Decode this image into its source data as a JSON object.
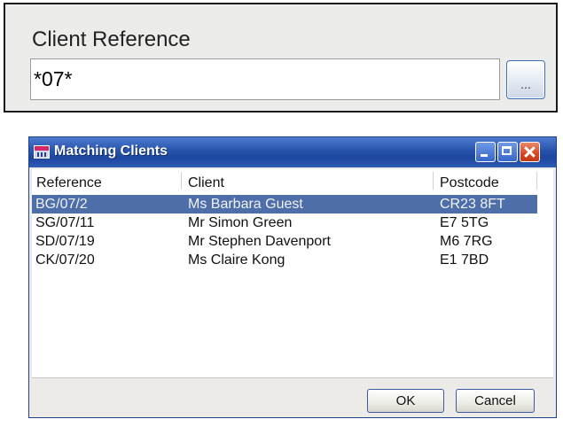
{
  "reference_panel": {
    "label": "Client Reference",
    "input_value": "*07*",
    "browse_label": "..."
  },
  "dialog": {
    "title": "Matching Clients",
    "columns": [
      "Reference",
      "Client",
      "Postcode"
    ],
    "rows": [
      {
        "reference": "BG/07/2",
        "client": "Ms Barbara Guest",
        "postcode": "CR23 8FT",
        "selected": true
      },
      {
        "reference": "SG/07/11",
        "client": "Mr Simon Green",
        "postcode": "E7 5TG",
        "selected": false
      },
      {
        "reference": "SD/07/19",
        "client": "Mr Stephen Davenport",
        "postcode": "M6 7RG",
        "selected": false
      },
      {
        "reference": "CK/07/20",
        "client": "Ms Claire Kong",
        "postcode": "E1 7BD",
        "selected": false
      }
    ],
    "ok_label": "OK",
    "cancel_label": "Cancel"
  },
  "icons": [
    "app-icon",
    "minimize-icon",
    "maximize-icon",
    "close-icon"
  ],
  "colors": {
    "titlebar": "#2752a9",
    "selection": "#4d6ea9",
    "close_button": "#d8451f"
  }
}
